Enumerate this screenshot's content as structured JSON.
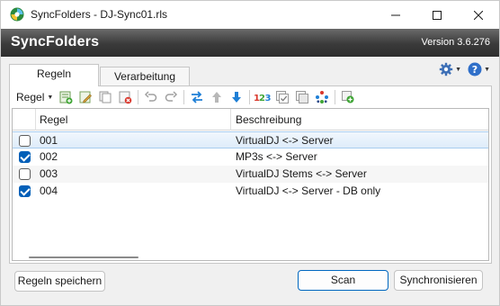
{
  "window": {
    "title": "SyncFolders - DJ-Sync01.rls"
  },
  "banner": {
    "app_name": "SyncFolders",
    "version": "Version 3.6.276"
  },
  "tabs": [
    {
      "label": "Regeln",
      "active": true
    },
    {
      "label": "Verarbeitung",
      "active": false
    }
  ],
  "toolbar": {
    "menu_label": "Regel",
    "icons": [
      "new-rule-icon",
      "edit-rule-icon",
      "copy-rule-icon",
      "delete-rule-icon",
      "undo-icon",
      "redo-icon",
      "swap-icon",
      "move-up-icon",
      "move-down-icon",
      "numbering-icon",
      "check-all-icon",
      "duplicate-icon",
      "color-dots-icon",
      "add-group-icon"
    ]
  },
  "grid": {
    "columns": [
      "Regel",
      "Beschreibung"
    ],
    "rows": [
      {
        "checked": false,
        "regel": "001",
        "beschreibung": "VirtualDJ <-> Server",
        "selected": true
      },
      {
        "checked": true,
        "regel": "002",
        "beschreibung": "MP3s <-> Server",
        "selected": false
      },
      {
        "checked": false,
        "regel": "003",
        "beschreibung": "VirtualDJ Stems <-> Server",
        "selected": false
      },
      {
        "checked": true,
        "regel": "004",
        "beschreibung": "VirtualDJ <-> Server - DB only",
        "selected": false
      }
    ]
  },
  "buttons": {
    "save_rules": "Regeln speichern",
    "scan": "Scan",
    "sync": "Synchronisieren"
  },
  "colors": {
    "accent": "#005fb8",
    "banner_dark": "#2e2e2e",
    "selection": "#deecfa"
  }
}
